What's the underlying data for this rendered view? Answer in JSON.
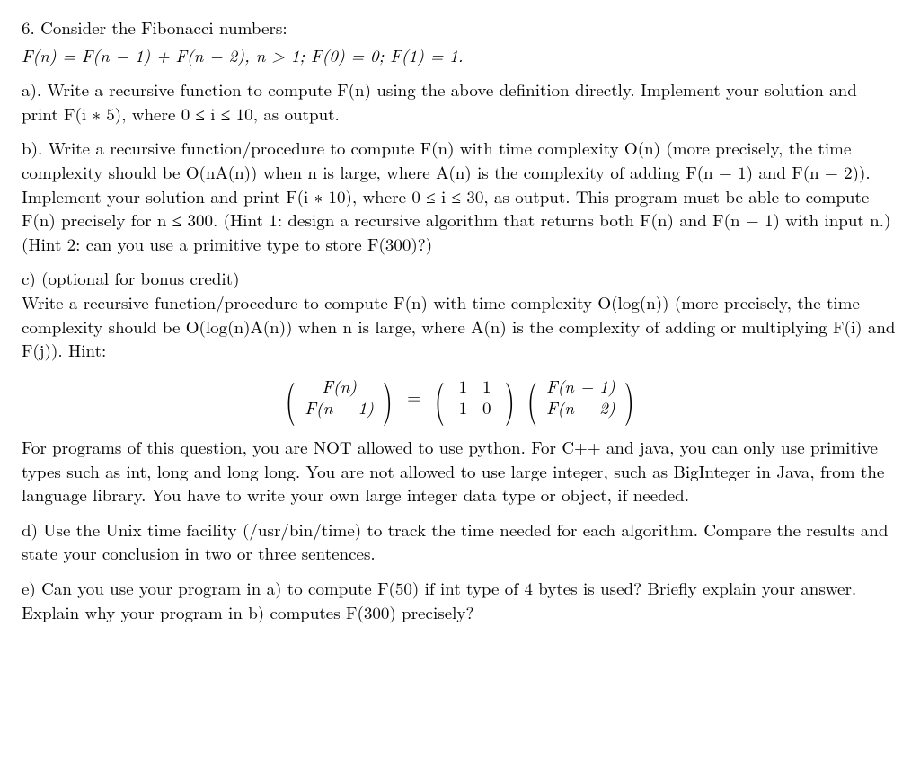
{
  "q6": {
    "header": "6. Consider the Fibonacci numbers:",
    "definition": "F(n) = F(n − 1) + F(n − 2),  n > 1;  F(0) = 0;  F(1) = 1.",
    "part_a": "a). Write a recursive function to compute F(n) using the above definition directly. Implement your solution and print F(i ∗ 5), where 0 ≤ i ≤ 10, as output.",
    "part_b": "b). Write a recursive function/procedure to compute F(n) with time complexity O(n) (more precisely, the time complexity should be O(nA(n)) when n is large, where A(n) is the complexity of adding F(n − 1) and F(n − 2)). Implement your solution and print F(i ∗ 10), where 0 ≤ i ≤ 30, as output. This program must be able to compute F(n) precisely for n ≤ 300. (Hint 1: design a recursive algorithm that returns both F(n) and F(n − 1) with input n.) (Hint 2: can you use a primitive type to store F(300)?)",
    "part_c_head": "c) (optional for bonus credit)",
    "part_c_body": "Write a recursive function/procedure to compute F(n) with time complexity O(log(n)) (more precisely, the time complexity should be O(log(n)A(n)) when n is large, where A(n) is the complexity of adding or multiplying F(i) and F(j)). Hint:",
    "matrix": {
      "left_top": "F(n)",
      "left_bottom": "F(n − 1)",
      "mid_r1c1": "1",
      "mid_r1c2": "1",
      "mid_r2c1": "1",
      "mid_r2c2": "0",
      "right_top": "F(n − 1)",
      "right_bottom": "F(n − 2)"
    },
    "constraints": "For programs of this question, you are NOT allowed to use python. For C++ and java, you can only use primitive types such as int, long and long long. You are not allowed to use large integer, such as BigInteger in Java, from the language library. You have to write your own large integer data type or object, if needed.",
    "part_d": "d) Use the Unix time facility (/usr/bin/time) to track the time needed for each algorithm. Compare the results and state your conclusion in two or three sentences.",
    "part_e": "e) Can you use your program in a) to compute F(50) if int type of 4 bytes is used? Briefly explain your answer. Explain why your program in b) computes F(300) precisely?"
  }
}
